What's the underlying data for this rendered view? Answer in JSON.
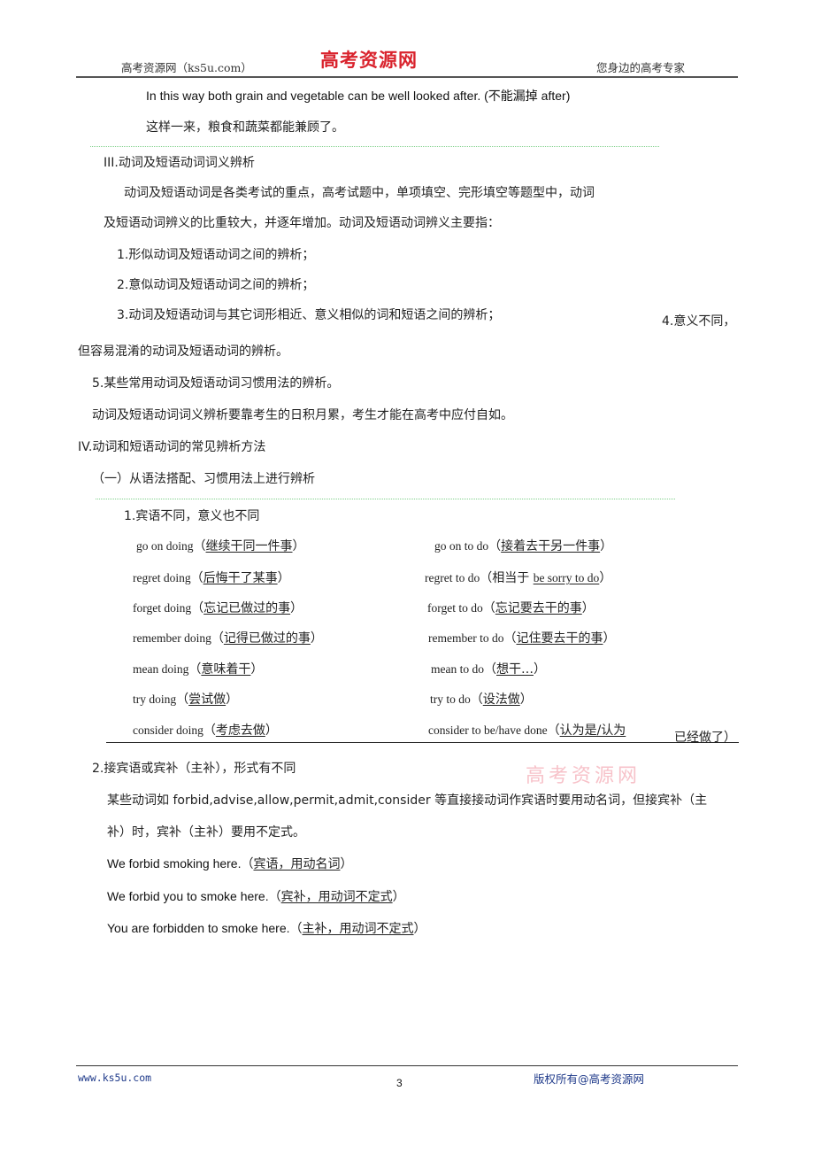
{
  "header": {
    "left": "高考资源网（ks5u.com）",
    "logo": "高考资源网",
    "right": "您身边的高考专家"
  },
  "intro": {
    "example_en": "In this way both grain and vegetable can be well looked after. (不能漏掉 after)",
    "example_cn": "这样一来，粮食和蔬菜都能兼顾了。"
  },
  "section3": {
    "title": "III.动词及短语动词词义辨析",
    "para_line1": "动词及短语动词是各类考试的重点，高考试题中，单项填空、完形填空等题型中，动词",
    "para_line2": "及短语动词辨义的比重较大，并逐年增加。动词及短语动词辨义主要指：",
    "items": [
      "1.形似动词及短语动词之间的辨析；",
      "2.意似动词及短语动词之间的辨析；",
      "3.动词及短语动词与其它词形相近、意义相似的词和短语之间的辨析；",
      "4.意义不同，",
      "但容易混淆的动词及短语动词的辨析。",
      "5.某些常用动词及短语动词习惯用法的辨析。"
    ],
    "conclusion": "动词及短语动词词义辨析要靠考生的日积月累，考生才能在高考中应付自如。"
  },
  "section4": {
    "title": "IV.动词和短语动词的常见辨析方法",
    "subtitle": "（一）从语法搭配、习惯用法上进行辨析",
    "point1_title": "1.宾语不同，意义也不同",
    "pairs": [
      {
        "left_phrase": "go on doing",
        "left_meaning": "继续干同一件事",
        "right_phrase": "go on to do",
        "right_meaning": "接着去干另一件事"
      },
      {
        "left_phrase": "regret doing",
        "left_meaning": "后悔干了某事",
        "right_phrase": "regret to do",
        "right_prefix": "相当于 ",
        "right_meaning": "be sorry to do"
      },
      {
        "left_phrase": "forget doing",
        "left_meaning": "忘记已做过的事",
        "right_phrase": "forget to do",
        "right_meaning": "忘记要去干的事"
      },
      {
        "left_phrase": "remember doing",
        "left_meaning": "记得已做过的事",
        "right_phrase": "remember to do",
        "right_meaning": "记住要去干的事"
      },
      {
        "left_phrase": "mean doing",
        "left_meaning": "意味着干",
        "right_phrase": "mean to do",
        "right_meaning": "想干…"
      },
      {
        "left_phrase": "try doing",
        "left_meaning": "尝试做",
        "right_phrase": "try to do",
        "right_meaning": "设法做"
      },
      {
        "left_phrase": "consider  doing",
        "left_meaning": "考虑去做",
        "right_phrase": "consider  to  be/have  done",
        "right_meaning": "认为是/认为",
        "right_tail": "已经做了）"
      }
    ],
    "point2_title": "2.接宾语或宾补（主补），形式有不同",
    "point2_line1": "某些动词如 forbid,advise,allow,permit,admit,consider 等直接接动词作宾语时要用动名词，但接宾补（主",
    "point2_line2": "补）时，宾补（主补）要用不定式。",
    "examples": [
      {
        "sentence": "We forbid smoking here.",
        "note": "宾语，用动名词"
      },
      {
        "sentence": "We forbid you to smoke here.",
        "note": "宾补，用动词不定式"
      },
      {
        "sentence": "You are forbidden to smoke here.",
        "note": "主补，用动词不定式"
      }
    ]
  },
  "watermark": "高考资源网",
  "footer": {
    "left": "www.ks5u.com",
    "page": "3",
    "right": "版权所有@高考资源网"
  },
  "paren_open": "（",
  "paren_close": "）"
}
